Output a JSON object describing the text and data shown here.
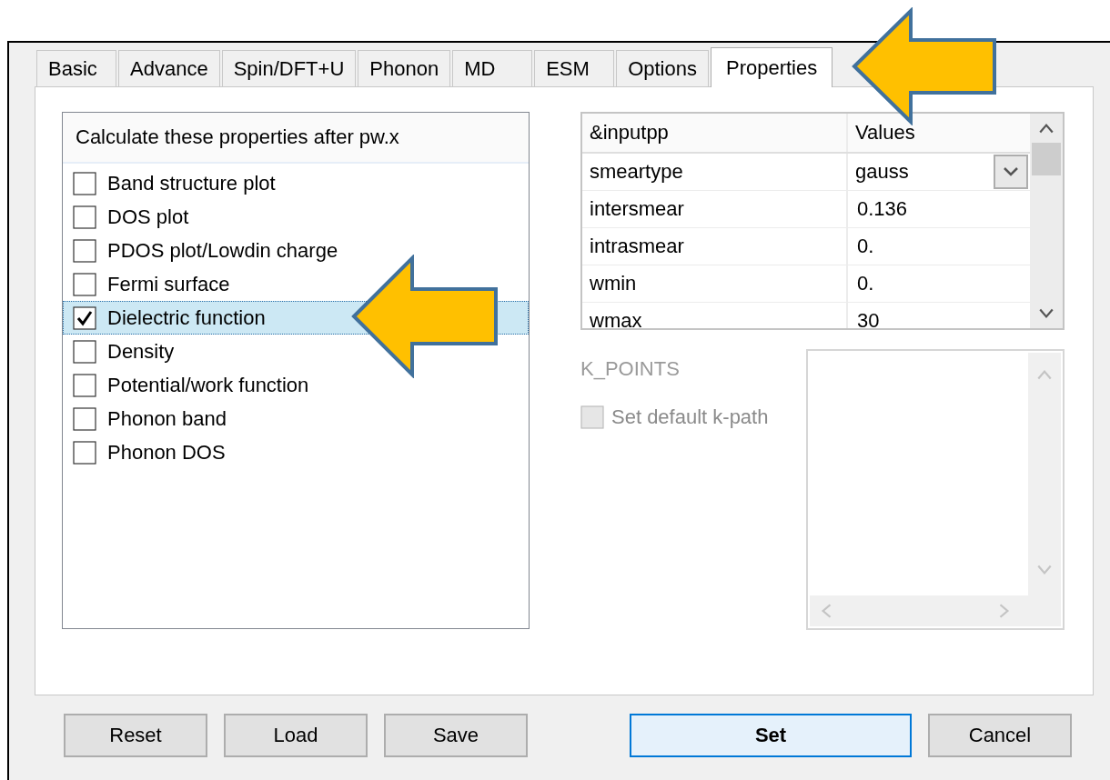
{
  "tabs": [
    {
      "label": "Basic",
      "selected": false
    },
    {
      "label": "Advance",
      "selected": false
    },
    {
      "label": "Spin/DFT+U",
      "selected": false
    },
    {
      "label": "Phonon",
      "selected": false
    },
    {
      "label": "MD",
      "selected": false
    },
    {
      "label": "ESM",
      "selected": false
    },
    {
      "label": "Options",
      "selected": false
    },
    {
      "label": "Properties",
      "selected": true
    }
  ],
  "properties": {
    "title": "Calculate these properties after pw.x",
    "items": [
      {
        "label": "Band structure plot",
        "checked": false,
        "selected": false
      },
      {
        "label": "DOS plot",
        "checked": false,
        "selected": false
      },
      {
        "label": "PDOS plot/Lowdin charge",
        "checked": false,
        "selected": false
      },
      {
        "label": "Fermi surface",
        "checked": false,
        "selected": false
      },
      {
        "label": "Dielectric function",
        "checked": true,
        "selected": true
      },
      {
        "label": "Density",
        "checked": false,
        "selected": false
      },
      {
        "label": "Potential/work function",
        "checked": false,
        "selected": false
      },
      {
        "label": "Phonon band",
        "checked": false,
        "selected": false
      },
      {
        "label": "Phonon DOS",
        "checked": false,
        "selected": false
      }
    ]
  },
  "parameters": {
    "columns": [
      "&inputpp",
      "Values"
    ],
    "rows": [
      {
        "name": "smeartype",
        "value": "gauss",
        "kind": "dropdown"
      },
      {
        "name": "intersmear",
        "value": "0.136",
        "kind": "text"
      },
      {
        "name": "intrasmear",
        "value": "0.",
        "kind": "text"
      },
      {
        "name": "wmin",
        "value": "0.",
        "kind": "text"
      },
      {
        "name": "wmax",
        "value": "30",
        "kind": "text"
      }
    ]
  },
  "k_points": {
    "label": "K_POINTS",
    "disabled": true,
    "default_path": {
      "label": "Set default k-path",
      "checked": false,
      "disabled": true
    }
  },
  "buttons": [
    {
      "label": "Reset",
      "default": false
    },
    {
      "label": "Load",
      "default": false
    },
    {
      "label": "Save",
      "default": false
    },
    {
      "label": "Set",
      "default": true
    },
    {
      "label": "Cancel",
      "default": false
    }
  ]
}
